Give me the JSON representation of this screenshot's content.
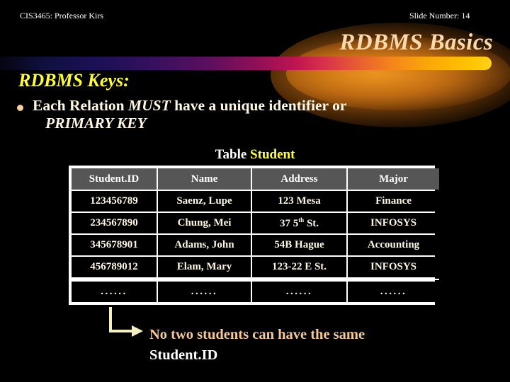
{
  "header": {
    "left": "CIS3465: Professor Kirs",
    "right": "Slide Number: 14"
  },
  "title": "RDBMS Basics",
  "body": {
    "section_heading": "RDBMS Keys:",
    "bullet": {
      "marker": "bullet-dot",
      "part1": "Each Relation ",
      "emphasis1": "MUST",
      "part2": " have a unique identifier or",
      "line2": "PRIMARY KEY"
    }
  },
  "table_caption": {
    "prefix": "Table ",
    "table_name": "Student"
  },
  "table": {
    "columns": [
      "Student.ID",
      "Name",
      "Address",
      "Major"
    ],
    "rows": [
      [
        "123456789",
        "Saenz, Lupe",
        "123 Mesa",
        "Finance"
      ],
      [
        "234567890",
        "Chung, Mei",
        "37 5th St.",
        "INFOSYS"
      ],
      [
        "345678901",
        "Adams, John",
        "54B Hague",
        "Accounting"
      ],
      [
        "456789012",
        "Elam, Mary",
        "123-22 E St.",
        "INFOSYS"
      ],
      [
        "......",
        "......",
        "......",
        "......"
      ]
    ],
    "address_superscript_row": 1,
    "address_base": "37 5",
    "address_sup": "th",
    "address_tail": " St."
  },
  "callout": {
    "line1": "No two students can have the same",
    "line2": "Student.ID"
  },
  "colors": {
    "background": "#000000",
    "title": "#fcd9ac",
    "heading_yellow": "#ffff33",
    "body_text": "#fdf6e3",
    "callout_peach": "#f3c999",
    "arrow": "#f5f0c0",
    "table_header_bg": "#565656",
    "table_border": "#ffffff",
    "band_start": "#050511",
    "band_end": "#ffd21a",
    "glow": "#d87e18"
  }
}
